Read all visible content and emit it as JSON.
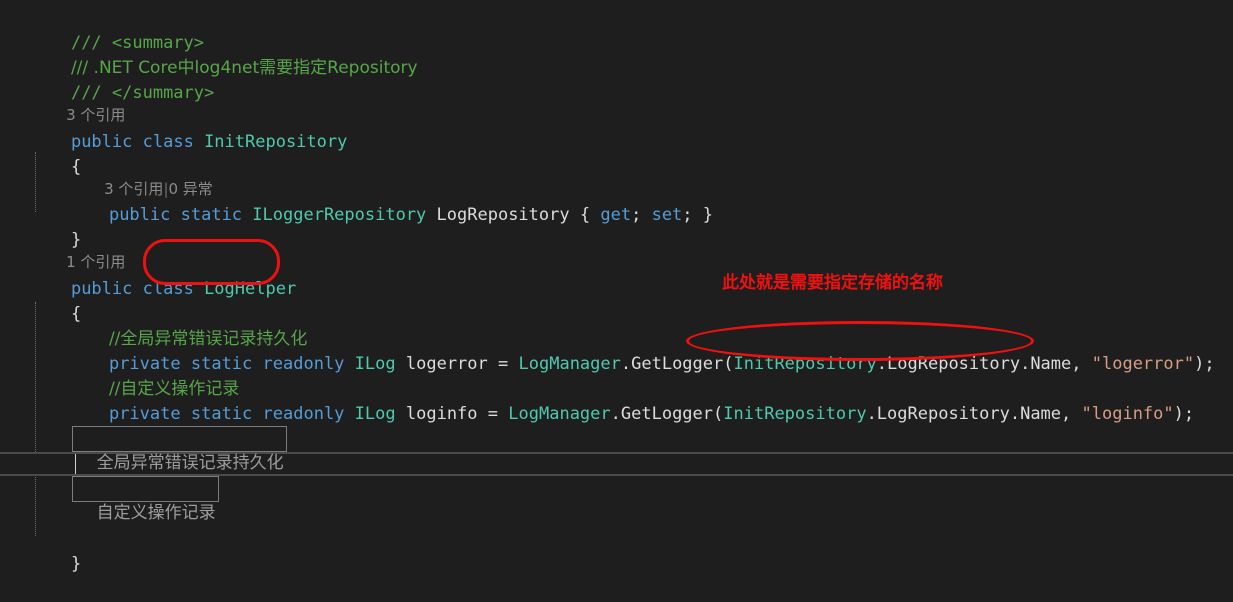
{
  "editor": {
    "background_color": "#1e1e1e",
    "foreground_color": "#dcdcdc",
    "language": "csharp"
  },
  "colors": {
    "keyword": "#569cd6",
    "type": "#4ec9b0",
    "string": "#d69d85",
    "comment": "#57a64a",
    "codelens": "#8c8c8c",
    "annotation_red": "#ee1111",
    "collapsed_border": "#7c7c7c",
    "current_line_rule": "#4a4a4a"
  },
  "code": {
    "doc_summary_open": "/// <summary>",
    "doc_summary_text": "/// .NET Core中log4net需要指定Repository",
    "doc_summary_close": "/// </summary>",
    "codelens_initrepository": "3 个引用",
    "class_initrepository": {
      "kw_public": "public",
      "kw_class": "class",
      "name": "InitRepository"
    },
    "brace_open_1": "{",
    "codelens_property": "3 个引用",
    "codelens_property_sep": "|",
    "codelens_property_exceptions": "0 异常",
    "property_logrepository": {
      "kw_public": "public",
      "kw_static": "static",
      "type": "ILoggerRepository",
      "name": "LogRepository",
      "accessors_open": "{",
      "get": "get",
      "semi1": ";",
      "set": "set",
      "semi2": ";",
      "accessors_close": "}"
    },
    "brace_close_1": "}",
    "codelens_loghelper": "1 个引用",
    "class_loghelper": {
      "kw_public": "public",
      "kw_class": "class",
      "name": "LogHelper"
    },
    "brace_open_2": "{",
    "comment_logerror": "//全局异常错误记录持久化",
    "field_logerror": {
      "kw_private": "private",
      "kw_static": "static",
      "kw_readonly": "readonly",
      "type": "ILog",
      "name": "logerror",
      "equals": "=",
      "class_call": "LogManager",
      "dot": ".",
      "method": "GetLogger",
      "paren_open": "(",
      "arg_type": "InitRepository",
      "arg_path": ".LogRepository.Name,",
      "arg_string": "\"logerror\"",
      "paren_close": ")",
      "semicolon": ";"
    },
    "comment_loginfo": "//自定义操作记录",
    "field_loginfo": {
      "kw_private": "private",
      "kw_static": "static",
      "kw_readonly": "readonly",
      "type": "ILog",
      "name": "loginfo",
      "equals": "=",
      "class_call": "LogManager",
      "dot": ".",
      "method": "GetLogger",
      "paren_open": "(",
      "arg_type": "InitRepository",
      "arg_path": ".LogRepository.Name,",
      "arg_string": "\"loginfo\"",
      "paren_close": ")",
      "semicolon": ";"
    },
    "collapsed_region_1": "全局异常错误记录持久化",
    "collapsed_region_2": "自定义操作记录",
    "brace_close_2": "}"
  },
  "annotations": {
    "note_text": "此处就是需要指定存储的名称",
    "oval_target_label": "InitRepository.LogRepository.Name,",
    "rrect_target_label": "LogHelper"
  }
}
